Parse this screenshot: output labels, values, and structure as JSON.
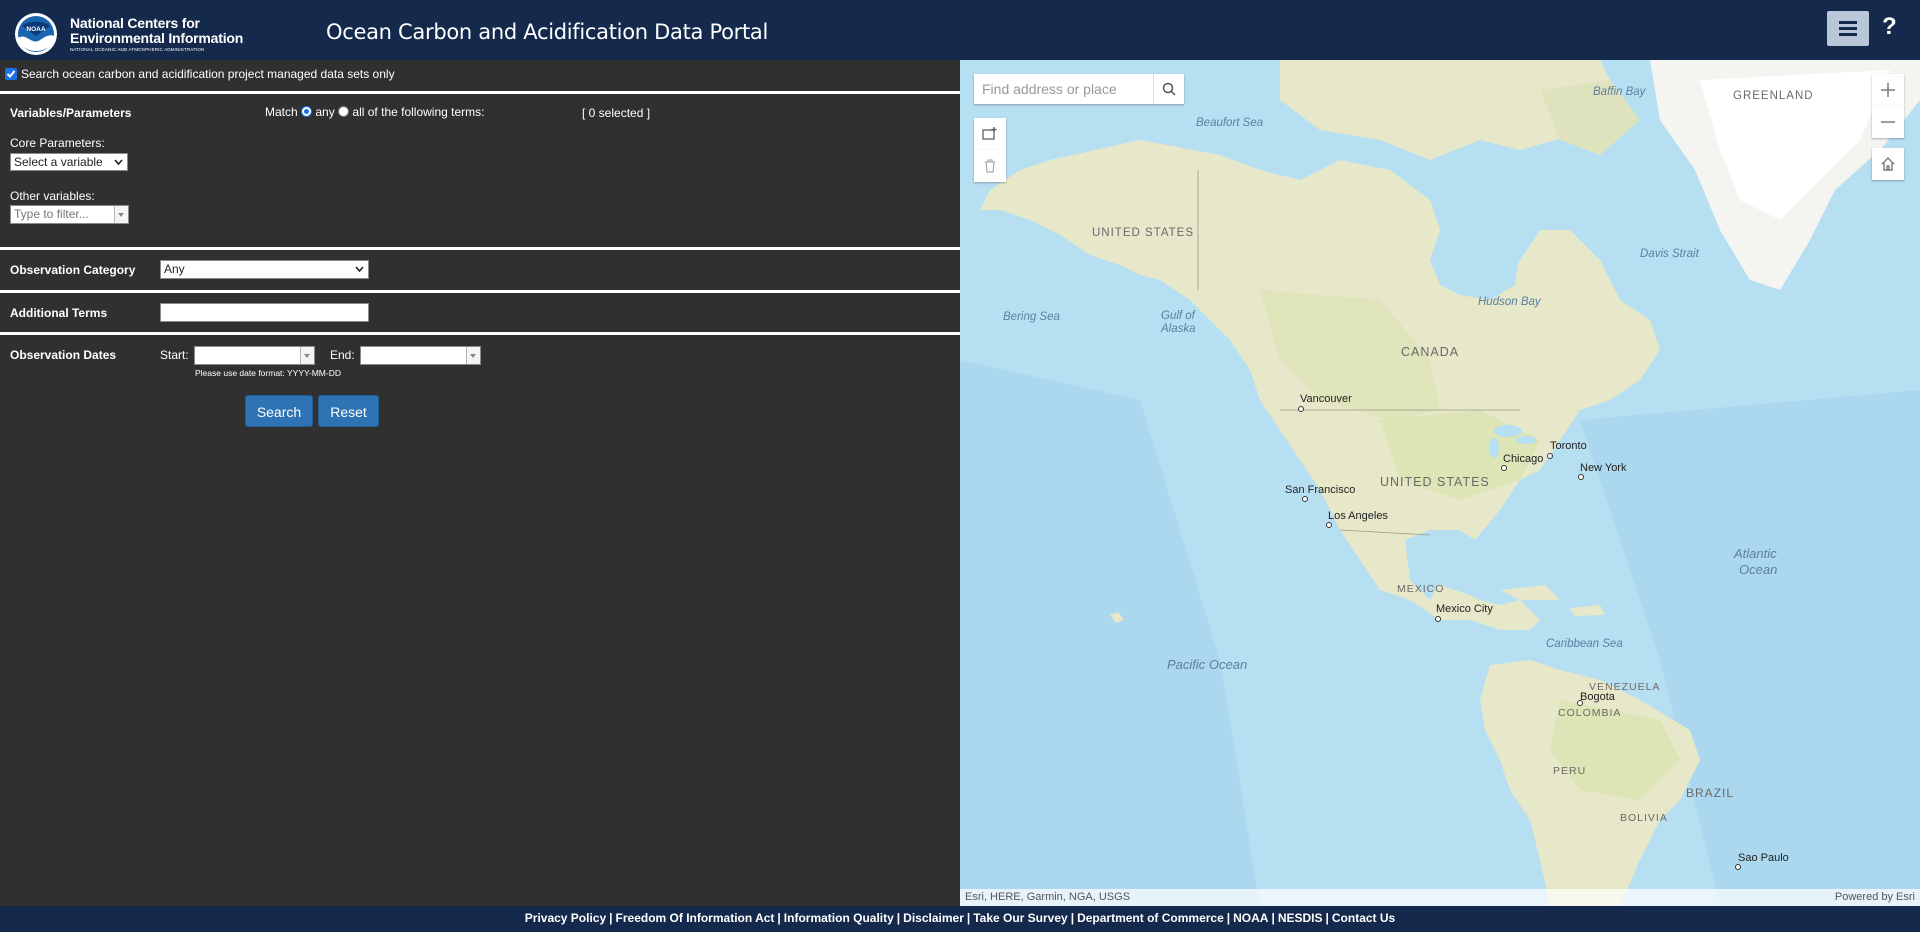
{
  "header": {
    "logo_line1": "National Centers for",
    "logo_line2": "Environmental Information",
    "logo_line3": "NATIONAL OCEANIC AND ATMOSPHERIC ADMINISTRATION",
    "logo_seal_text": "NOAA",
    "title": "Ocean Carbon and Acidification Data Portal",
    "menu_icon": "hamburger-icon",
    "help_label": "?"
  },
  "search_panel": {
    "scope_checkbox": {
      "label": "Search ocean carbon and acidification project managed data sets only",
      "checked": true
    },
    "variables": {
      "heading": "Variables/Parameters",
      "match_label": "Match",
      "match_any_label": "any",
      "match_all_label": "all of the following terms:",
      "match_selected": "any",
      "selected_count": "[ 0 selected ]",
      "core_label": "Core Parameters:",
      "core_select_value": "Select a variable",
      "other_label": "Other variables:",
      "other_placeholder": "Type to filter..."
    },
    "observation_category": {
      "heading": "Observation Category",
      "value": "Any"
    },
    "additional_terms": {
      "heading": "Additional Terms",
      "value": ""
    },
    "observation_dates": {
      "heading": "Observation Dates",
      "start_label": "Start:",
      "end_label": "End:",
      "hint": "Please use date format: YYYY-MM-DD"
    },
    "search_button": "Search",
    "reset_button": "Reset"
  },
  "map": {
    "search_placeholder": "Find address or place",
    "attribution_left": "Esri, HERE, Garmin, NGA, USGS",
    "attribution_right": "Powered by Esri",
    "labels": {
      "baffin_bay": "Baffin Bay",
      "greenland": "GREENLAND",
      "beaufort_sea": "Beaufort Sea",
      "united_states_ak": "UNITED STATES",
      "davis_strait": "Davis Strait",
      "hudson_bay": "Hudson Bay",
      "bering_sea": "Bering Sea",
      "gulf_of_alaska_1": "Gulf of",
      "gulf_of_alaska_2": "Alaska",
      "canada": "CANADA",
      "vancouver": "Vancouver",
      "toronto": "Toronto",
      "chicago": "Chicago",
      "new_york": "New York",
      "san_francisco": "San Francisco",
      "united_states": "UNITED STATES",
      "los_angeles": "Los Angeles",
      "atlantic_1": "Atlantic",
      "atlantic_2": "Ocean",
      "mexico": "MEXICO",
      "mexico_city": "Mexico City",
      "caribbean_sea": "Caribbean Sea",
      "pacific_ocean": "Pacific Ocean",
      "venezuela": "VENEZUELA",
      "bogota": "Bogota",
      "colombia": "COLOMBIA",
      "peru": "PERU",
      "brazil": "BRAZIL",
      "bolivia": "BOLIVIA",
      "sao_paulo": "Sao Paulo"
    }
  },
  "footer": {
    "links": [
      "Privacy Policy",
      "Freedom Of Information Act",
      "Information Quality",
      "Disclaimer",
      "Take Our Survey",
      "Department of Commerce",
      "NOAA",
      "NESDIS",
      "Contact Us"
    ],
    "separator": "|"
  },
  "colors": {
    "header_bg": "#14294b",
    "panel_bg": "#303030",
    "button_bg": "#2e74b5",
    "ocean": "#b4dcef",
    "land": "#e6e8c9"
  }
}
